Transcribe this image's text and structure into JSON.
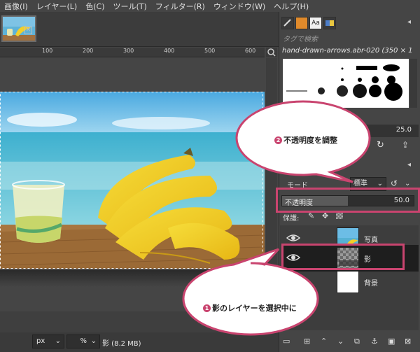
{
  "menu": [
    "画像(I)",
    "レイヤー(L)",
    "色(C)",
    "ツール(T)",
    "フィルター(R)",
    "ウィンドウ(W)",
    "ヘルプ(H)"
  ],
  "ruler": {
    "ticks": [
      "100",
      "200",
      "300",
      "400",
      "500",
      "600"
    ]
  },
  "status": {
    "unit": "px",
    "zoom": "%",
    "info": "影 (8.2 MB)"
  },
  "brushes": {
    "search_placeholder": "タグで検索",
    "selected_name": "hand-drawn-arrows.abr-020 (350 × 1",
    "spacing_value": "25.0"
  },
  "layers": {
    "mode_label": "モード",
    "mode_value": "標準",
    "opacity_label": "不透明度",
    "opacity_value": "50.0",
    "opacity_fraction": 0.5,
    "lock_label": "保護:",
    "items": [
      {
        "name": "写真",
        "selected": false
      },
      {
        "name": "影",
        "selected": true
      },
      {
        "name": "背景",
        "selected": false
      }
    ]
  },
  "annotations": {
    "bubble1": {
      "number": "1",
      "text": "影のレイヤーを選択中に"
    },
    "bubble2": {
      "number": "2",
      "text": "不透明度を調整"
    }
  },
  "colors": {
    "accent": "#c9446f",
    "panel": "#454545"
  }
}
